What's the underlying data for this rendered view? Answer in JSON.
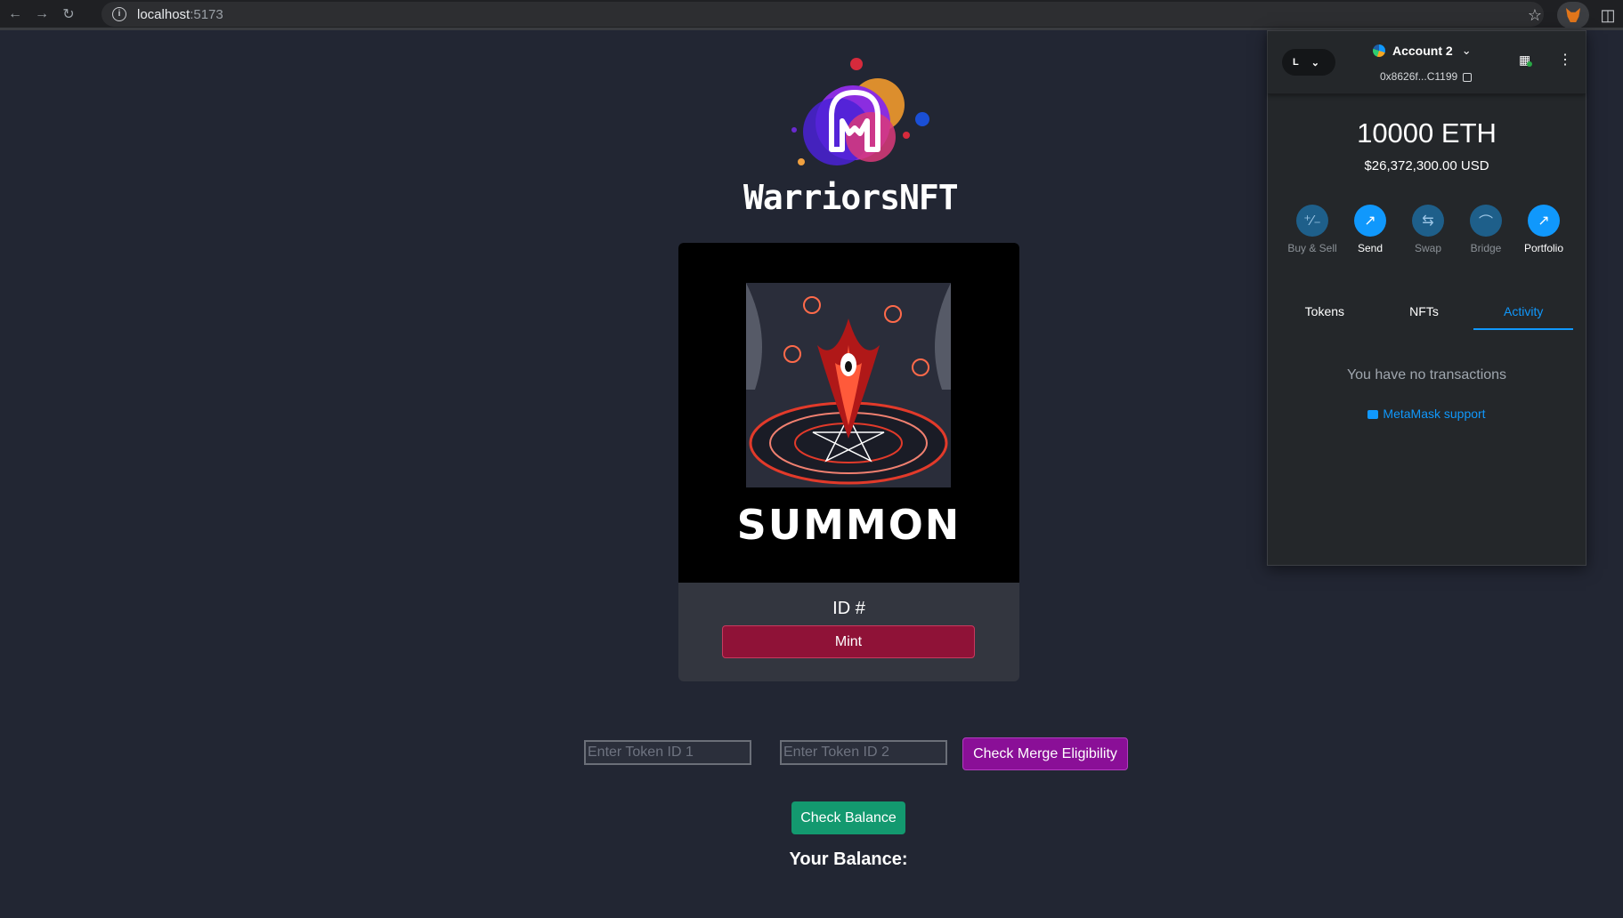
{
  "browser": {
    "url_host": "localhost",
    "url_port": ":5173"
  },
  "app": {
    "brand": "WarriorsNFT",
    "card": {
      "image_text": "SUMMON",
      "id_label": "ID #",
      "mint_label": "Mint"
    },
    "merge": {
      "token1_placeholder": "Enter Token ID 1",
      "token2_placeholder": "Enter Token ID 2",
      "check_label": "Check Merge Eligibility"
    },
    "balance": {
      "check_label": "Check Balance",
      "label": "Your Balance:"
    }
  },
  "metamask": {
    "network_initial": "L",
    "account_name": "Account 2",
    "address_short": "0x8626f...C1199",
    "balance_eth": "10000 ETH",
    "balance_usd": "$26,372,300.00 USD",
    "actions": [
      {
        "label": "Buy & Sell",
        "icon": "buy-sell-icon"
      },
      {
        "label": "Send",
        "icon": "send-icon"
      },
      {
        "label": "Swap",
        "icon": "swap-icon"
      },
      {
        "label": "Bridge",
        "icon": "bridge-icon"
      },
      {
        "label": "Portfolio",
        "icon": "portfolio-icon"
      }
    ],
    "tabs": [
      "Tokens",
      "NFTs",
      "Activity"
    ],
    "active_tab": "Activity",
    "empty_message": "You have no transactions",
    "support_link": "MetaMask support"
  },
  "colors": {
    "page_bg": "#222633",
    "mint": "#8f1237",
    "merge": "#8a0f97",
    "balance": "#13996f",
    "metamask_accent": "#1098fc"
  }
}
